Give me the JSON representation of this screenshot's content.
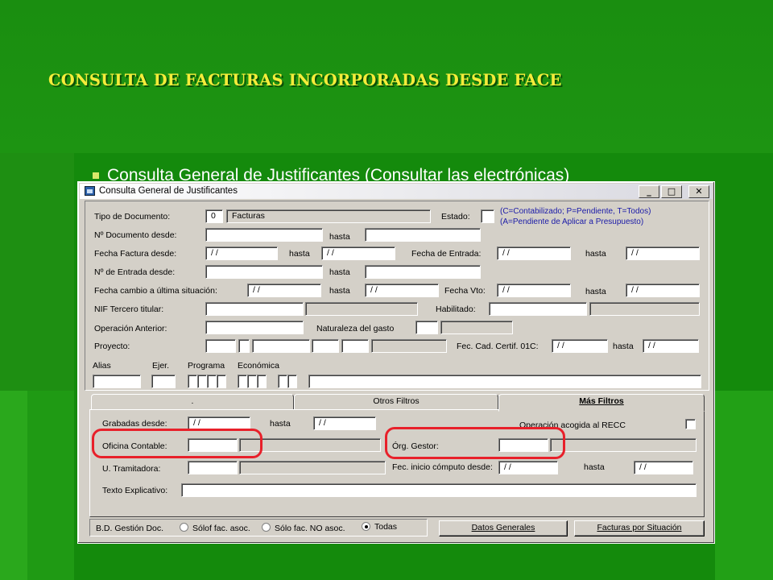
{
  "slide": {
    "title": "CONSULTA DE FACTURAS INCORPORADAS DESDE FACE",
    "bullet": "Consulta General de Justificantes (Consultar las electrónicas)"
  },
  "window": {
    "title": "Consulta General de Justificantes",
    "controls": {
      "minimize": "_",
      "maximize": "□",
      "close": "✕"
    }
  },
  "form": {
    "tipo_documento": {
      "label": "Tipo de Documento:",
      "code": "0",
      "description": "Facturas"
    },
    "estado": {
      "label": "Estado:",
      "hint_line1": "(C=Contabilizado; P=Pendiente, T=Todos)",
      "hint_line2": "(A=Pendiente de Aplicar a Presupuesto)"
    },
    "num_documento_desde": {
      "label": "Nº Documento desde:",
      "value": ""
    },
    "hasta_label": "hasta",
    "fecha_factura_desde": {
      "label": "Fecha Factura desde:",
      "value": "/ /",
      "hasta_value": "/ /"
    },
    "fecha_entrada": {
      "label": "Fecha de Entrada:",
      "value": "/ /",
      "hasta_value": "/ /"
    },
    "num_entrada_desde": {
      "label": "Nº de Entrada desde:",
      "value": ""
    },
    "fecha_cambio": {
      "label": "Fecha cambio a última situación:",
      "value": "/ /",
      "hasta_value": "/ /"
    },
    "fecha_vto": {
      "label": "Fecha Vto:",
      "value": "/ /",
      "hasta_value": "/ /"
    },
    "nif_tercero": {
      "label": "NIF Tercero titular:",
      "value": ""
    },
    "habilitado": {
      "label": "Habilitado:",
      "value": ""
    },
    "operacion_anterior": {
      "label": "Operación Anterior:",
      "value": ""
    },
    "naturaleza_gasto": {
      "label": "Naturaleza del gasto",
      "value": ""
    },
    "proyecto": {
      "label": "Proyecto:"
    },
    "fec_cad_certif": {
      "label": "Fec. Cad. Certif. 01C:",
      "value": "/ /",
      "hasta_value": "/ /"
    },
    "aplicacion_headers": {
      "alias": "Alias",
      "ejer": "Ejer.",
      "programa": "Programa",
      "economica": "Económica"
    }
  },
  "tabs": [
    {
      "label": "."
    },
    {
      "label": "Otros Filtros"
    },
    {
      "label": "Más Filtros",
      "active": true
    }
  ],
  "mas_filtros": {
    "grabadas_desde": {
      "label": "Grabadas desde:",
      "value": "/ /",
      "hasta_value": "/ /"
    },
    "operacion_recc": {
      "label": "Operación acogida al RECC"
    },
    "oficina_contable": {
      "label": "Oficina Contable:",
      "value": ""
    },
    "org_gestor": {
      "label": "Órg. Gestor:",
      "value": ""
    },
    "u_tramitadora": {
      "label": "U. Tramitadora:",
      "value": ""
    },
    "fec_inicio_computo": {
      "label": "Fec. inicio cómputo desde:",
      "value": "/ /",
      "hasta_value": "/ /"
    },
    "texto_explicativo": {
      "label": "Texto Explicativo:",
      "value": ""
    }
  },
  "footer": {
    "bd_label": "B.D. Gestión Doc.",
    "radios": [
      {
        "label": "Sólof fac. asoc.",
        "selected": false
      },
      {
        "label": "Sólo fac. NO asoc.",
        "selected": false
      },
      {
        "label": "Todas",
        "selected": true
      }
    ],
    "datos_generales": "Datos Generales",
    "facturas_situacion": "Facturas por Situación"
  },
  "colors": {
    "slide_bg": "#1e8f12",
    "title": "#f5ec3a",
    "highlight": "#e8202a",
    "hint": "#1a1aa8"
  }
}
